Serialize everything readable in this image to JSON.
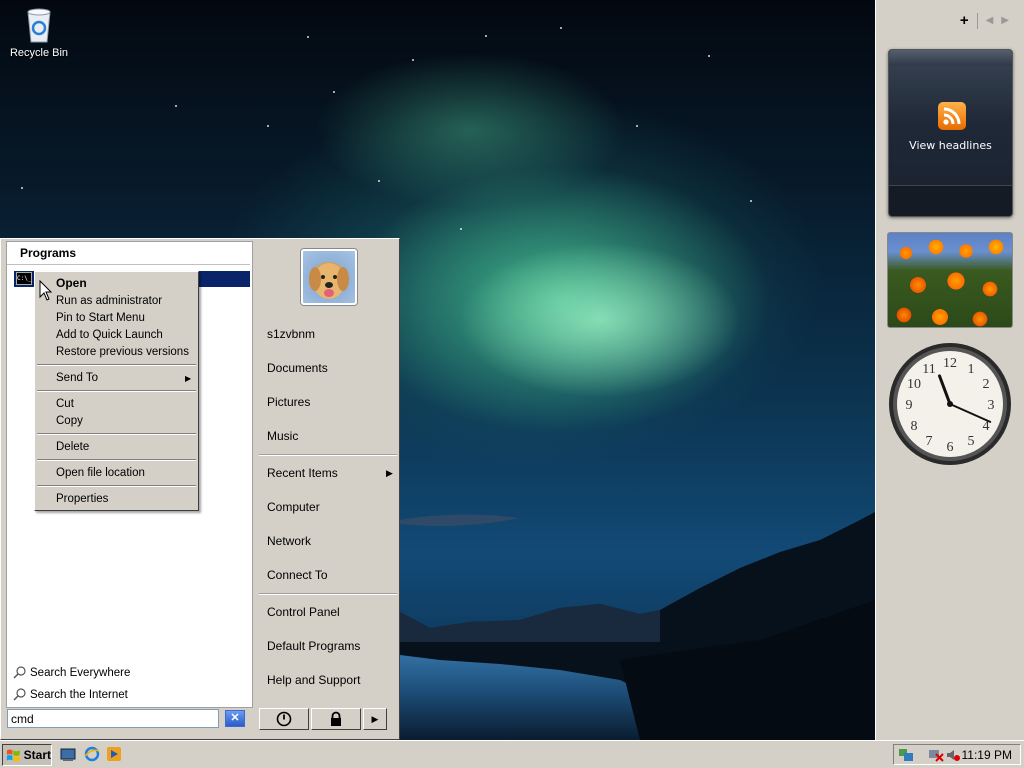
{
  "desktop": {
    "recycle_bin_label": "Recycle Bin"
  },
  "sidebar": {
    "add_icon": "plus-icon",
    "rss_gadget_label": "View headlines",
    "clock": {
      "hour": 11,
      "minute": 19
    }
  },
  "start_menu": {
    "programs_header": "Programs",
    "program_item_icon": "cmd-icon",
    "search_everywhere": "Search Everywhere",
    "search_internet": "Search the Internet",
    "search_value": "cmd",
    "right_items": {
      "username": "s1zvbnm",
      "documents": "Documents",
      "pictures": "Pictures",
      "music": "Music",
      "recent_items": "Recent Items",
      "computer": "Computer",
      "network": "Network",
      "connect_to": "Connect To",
      "control_panel": "Control Panel",
      "default_programs": "Default Programs",
      "help_support": "Help and Support"
    }
  },
  "context_menu": {
    "open": "Open",
    "run_as_admin": "Run as administrator",
    "pin_start": "Pin to Start Menu",
    "add_quick_launch": "Add to Quick Launch",
    "restore_versions": "Restore previous versions",
    "send_to": "Send To",
    "cut": "Cut",
    "copy": "Copy",
    "delete": "Delete",
    "open_location": "Open file location",
    "properties": "Properties"
  },
  "taskbar": {
    "start_label": "Start",
    "clock": "11:19 PM"
  },
  "colors": {
    "selection": "#0a246a",
    "window_face": "#d4d0c8",
    "rss_orange": "#f08a1e"
  }
}
